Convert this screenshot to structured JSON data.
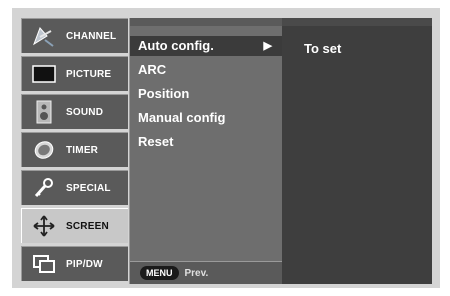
{
  "menu": {
    "items": [
      {
        "label": "CHANNEL",
        "icon": "satellite-dish-icon"
      },
      {
        "label": "PICTURE",
        "icon": "tv-screen-icon"
      },
      {
        "label": "SOUND",
        "icon": "speaker-icon"
      },
      {
        "label": "TIMER",
        "icon": "clock-icon"
      },
      {
        "label": "SPECIAL",
        "icon": "key-icon"
      },
      {
        "label": "SCREEN",
        "icon": "move-arrows-icon"
      },
      {
        "label": "PIP/DW",
        "icon": "pip-windows-icon"
      }
    ],
    "selected": "SCREEN"
  },
  "submenu": {
    "items": [
      {
        "label": "Auto config.",
        "arrow": "▶"
      },
      {
        "label": "ARC"
      },
      {
        "label": "Position"
      },
      {
        "label": "Manual config"
      },
      {
        "label": "Reset"
      }
    ],
    "selected": "Auto config."
  },
  "footer": {
    "button_label": "MENU",
    "hint": "Prev."
  },
  "right_panel": {
    "value": "To set"
  },
  "colors": {
    "panel_bg": "#d4d4d4",
    "menu_item_bg": "#5a5a5a",
    "selected_bg": "#c8c8c8",
    "submenu_bg": "#6e6e6e",
    "right_bg": "#3e3e3e"
  }
}
